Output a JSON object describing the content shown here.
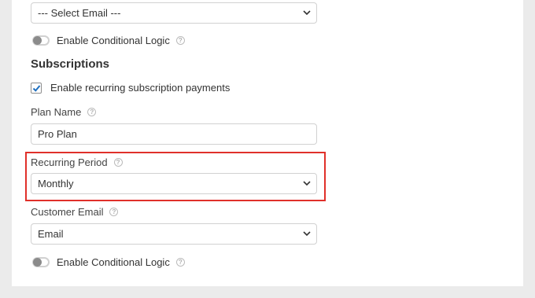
{
  "top_select": {
    "value": "--- Select Email ---"
  },
  "conditional_logic_1": {
    "label": "Enable Conditional Logic",
    "help": "?"
  },
  "subscriptions": {
    "title": "Subscriptions",
    "recurring_checkbox": {
      "label": "Enable recurring subscription payments",
      "checked": true
    },
    "plan_name": {
      "label": "Plan Name",
      "help": "?",
      "value": "Pro Plan"
    },
    "recurring_period": {
      "label": "Recurring Period",
      "help": "?",
      "value": "Monthly"
    },
    "customer_email": {
      "label": "Customer Email",
      "help": "?",
      "value": "Email"
    },
    "conditional_logic_2": {
      "label": "Enable Conditional Logic",
      "help": "?"
    }
  },
  "colors": {
    "highlight_border": "#e0302a",
    "checkbox_check": "#1e6fbf"
  }
}
